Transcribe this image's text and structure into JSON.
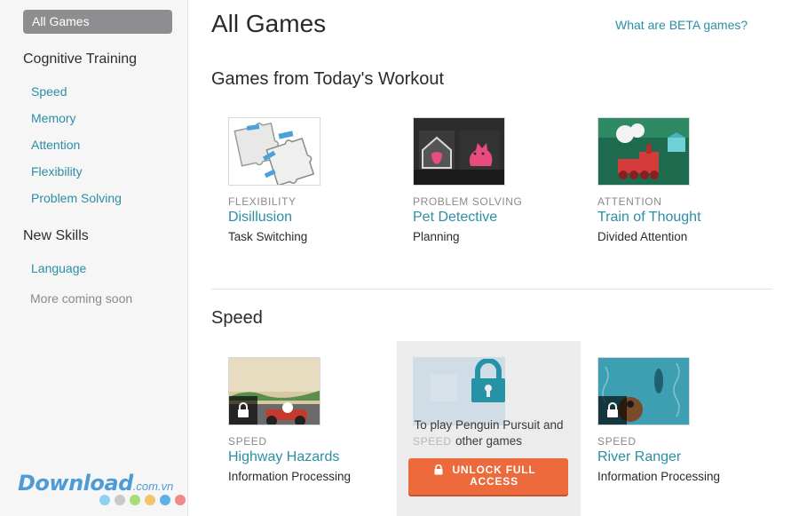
{
  "sidebar": {
    "active": "All Games",
    "groups": [
      {
        "heading": "Cognitive Training",
        "items": [
          "Speed",
          "Memory",
          "Attention",
          "Flexibility",
          "Problem Solving"
        ]
      },
      {
        "heading": "New Skills",
        "items": [
          "Language"
        ],
        "muted": "More coming soon"
      }
    ]
  },
  "main": {
    "title": "All Games",
    "beta_link": "What are BETA games?",
    "sections": [
      {
        "title": "Games from Today's Workout",
        "games": [
          {
            "category": "FLEXIBILITY",
            "name": "Disillusion",
            "subtitle": "Task Switching"
          },
          {
            "category": "PROBLEM SOLVING",
            "name": "Pet Detective",
            "subtitle": "Planning"
          },
          {
            "category": "ATTENTION",
            "name": "Train of Thought",
            "subtitle": "Divided Attention"
          }
        ]
      },
      {
        "title": "Speed",
        "games": [
          {
            "category": "SPEED",
            "name": "Highway Hazards",
            "subtitle": "Information Processing",
            "locked": true
          },
          {
            "category": "SPEED",
            "name": "Penguin Pursuit",
            "locked": true
          },
          {
            "category": "SPEED",
            "name": "River Ranger",
            "subtitle": "Information Processing",
            "locked": true
          }
        ]
      }
    ],
    "locked_card": {
      "message": "To play Penguin Pursuit and other games",
      "button": "UNLOCK FULL ACCESS"
    }
  },
  "watermark": {
    "text": "Download",
    "suffix": ".com.vn"
  },
  "colors": {
    "link": "#2b8fa3",
    "sidebar_active": "#8e8e91",
    "unlock_button": "#ec6a3c",
    "lock_teal": "#2592a5"
  }
}
